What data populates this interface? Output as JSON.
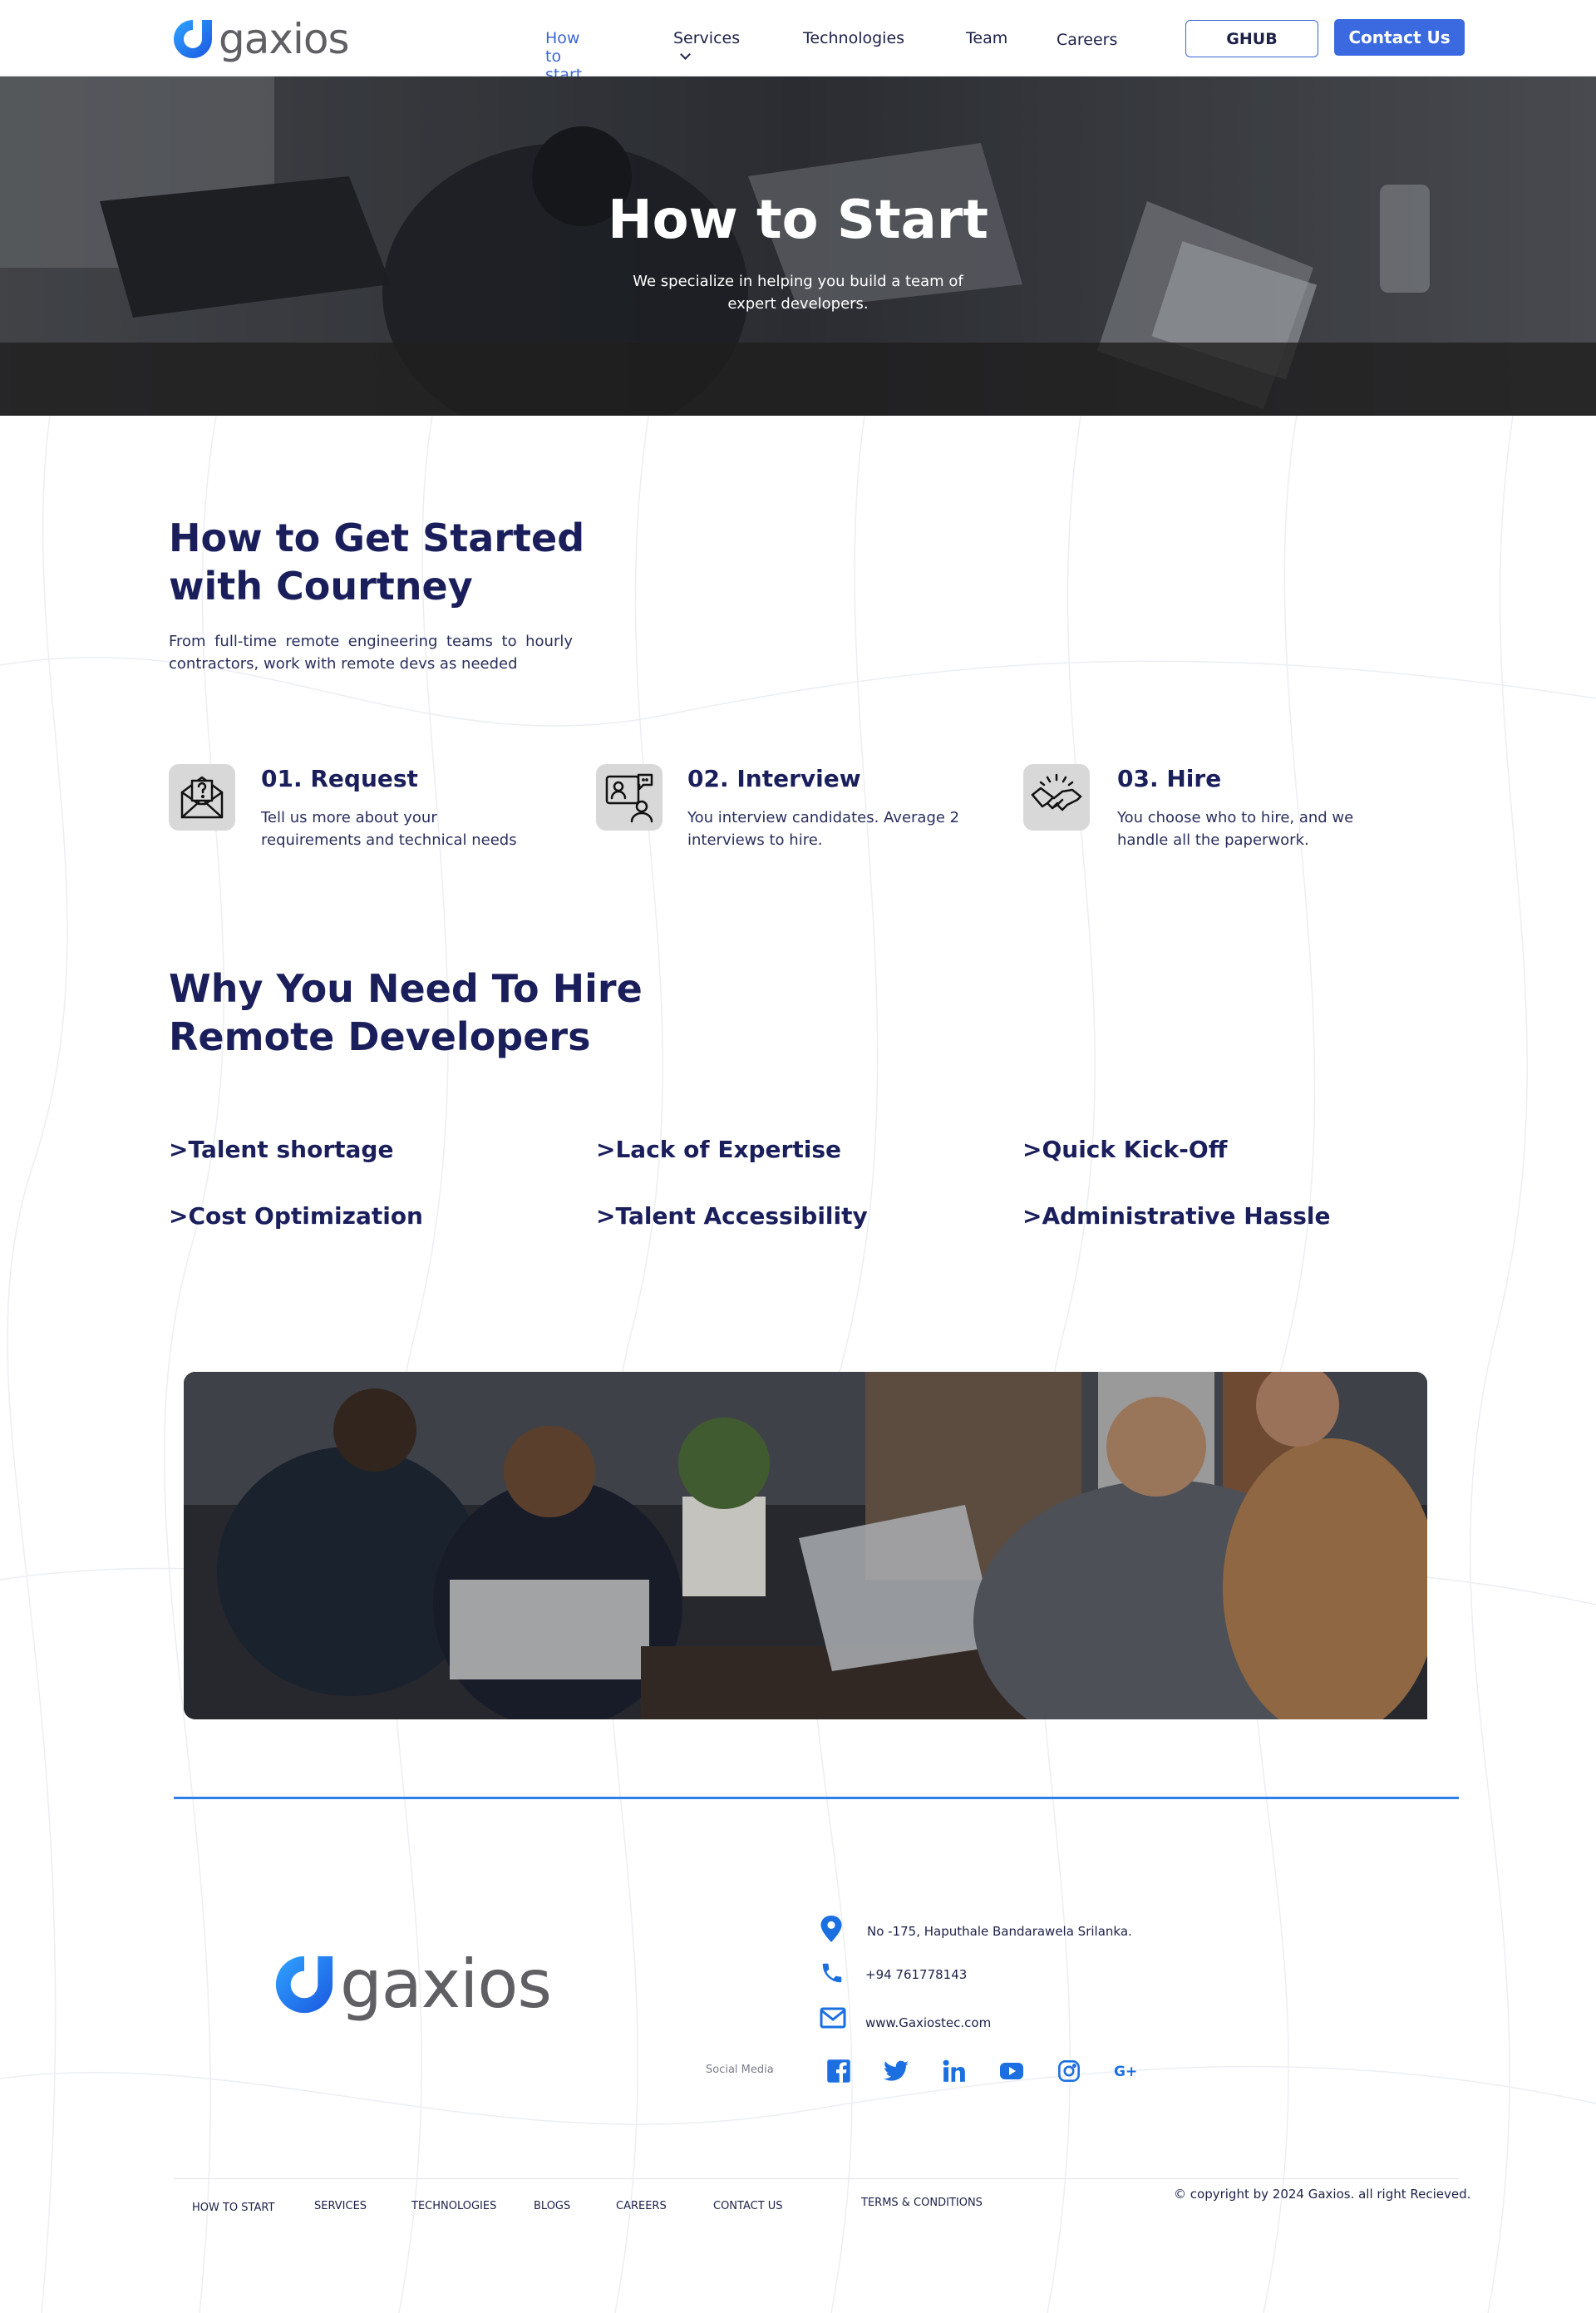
{
  "brand": {
    "name": "gaxios",
    "accent": "#3b6ae0",
    "navy": "#1a1f5c"
  },
  "nav": {
    "items": [
      {
        "label": "How to start",
        "active": true
      },
      {
        "label": "Services",
        "dropdown": true
      },
      {
        "label": "Technologies"
      },
      {
        "label": "Team"
      },
      {
        "label": "Careers"
      }
    ],
    "ghub_label": "GHUB",
    "contact_label": "Contact Us"
  },
  "hero": {
    "title": "How to Start",
    "subtitle": "We specialize in helping you build a team of expert developers."
  },
  "get_started": {
    "title": "How to Get Started with Courtney",
    "lead": "From full-time remote engineering teams to hourly contractors, work with remote devs as needed",
    "steps": [
      {
        "icon": "envelope-question-icon",
        "title": "01. Request",
        "desc": "Tell us more about your requirements and technical needs"
      },
      {
        "icon": "video-interview-icon",
        "title": "02. Interview",
        "desc": "You interview candidates. Average 2 interviews to hire."
      },
      {
        "icon": "handshake-icon",
        "title": "03. Hire",
        "desc": "You choose who to hire, and we handle all the paperwork."
      }
    ]
  },
  "why": {
    "title": "Why You Need To Hire Remote Developers",
    "reasons": [
      ">Talent shortage",
      ">Lack of Expertise",
      ">Quick Kick-Off",
      ">Cost Optimization",
      ">Talent Accessibility",
      ">Administrative Hassle"
    ]
  },
  "footer": {
    "address": "No -175, Haputhale Bandarawela Srilanka.",
    "phone": "+94 761778143",
    "website": "www.Gaxiostec.com",
    "social_label": "Social Media",
    "social_icons": [
      "facebook-icon",
      "twitter-icon",
      "linkedin-icon",
      "youtube-icon",
      "instagram-icon",
      "google-plus-icon"
    ],
    "links": [
      "HOW TO START",
      "SERVICES",
      "TECHNOLOGIES",
      "BLOGS",
      "CAREERS",
      "CONTACT US"
    ],
    "terms": "TERMS & CONDITIONS",
    "copyright": "© copyright by 2024 Gaxios. all right Recieved."
  }
}
